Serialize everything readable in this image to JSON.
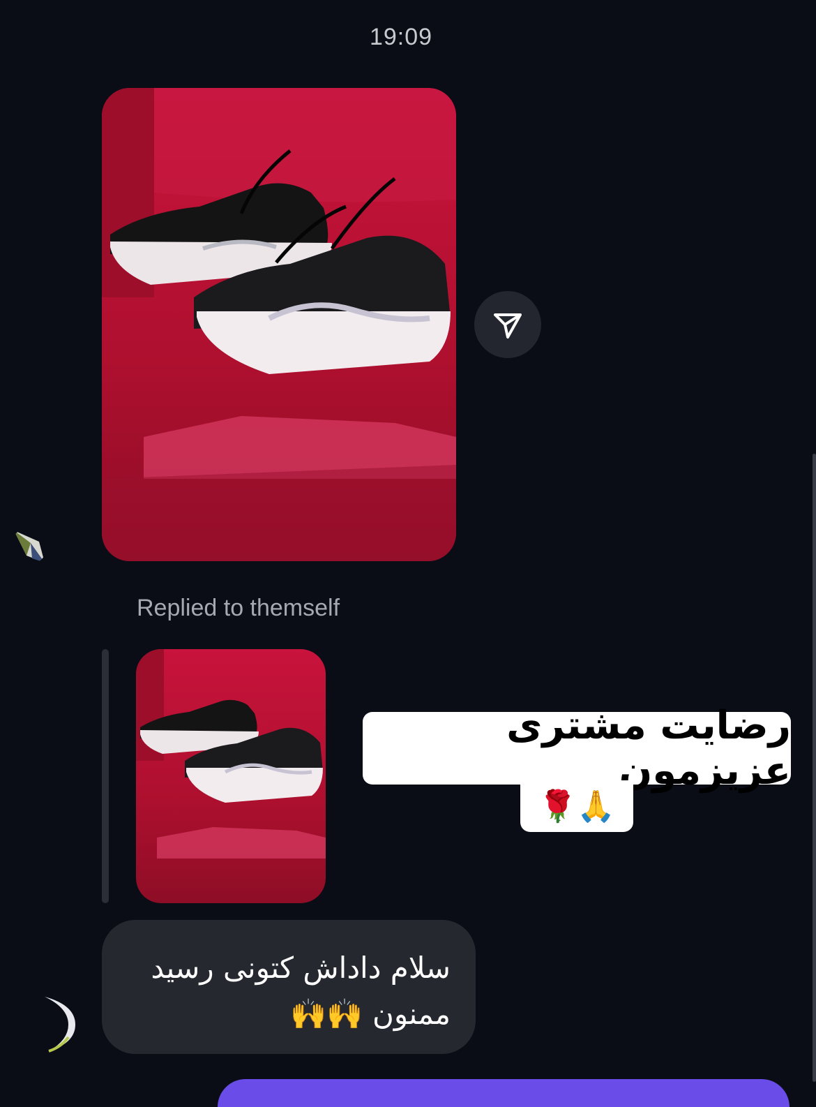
{
  "thread": {
    "timestamp": "19:09",
    "replied_label": "Replied to themself"
  },
  "sticker": {
    "line1": "رضایت مشتری عزیزمون",
    "line2": "🌹🙏"
  },
  "message": {
    "text": "سلام داداش کتونی رسید\nممنون 🙌🙌"
  },
  "colors": {
    "background": "#0b0d16",
    "bubble": "#262830",
    "accent": "#6a4de8"
  },
  "icons": {
    "share": "send-icon"
  }
}
